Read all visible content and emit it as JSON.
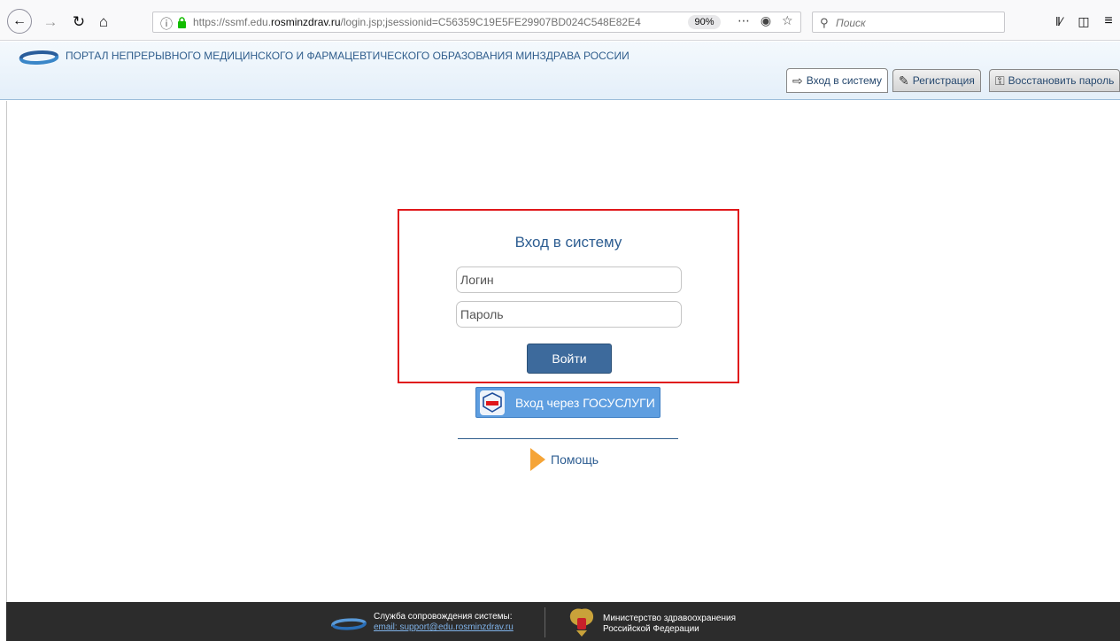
{
  "browser": {
    "url_prefix": "https://ssmf.edu.",
    "url_domain": "rosminzdrav.ru",
    "url_rest": "/login.jsp;jsessionid=C56359C19E5FE29907BD024C548E82E4",
    "zoom": "90%",
    "search_placeholder": "Поиск"
  },
  "header": {
    "title": "ПОРТАЛ НЕПРЕРЫВНОГО МЕДИЦИНСКОГО И ФАРМАЦЕВТИЧЕСКОГО ОБРАЗОВАНИЯ МИНЗДРАВА РОССИИ",
    "tabs": [
      {
        "label": "Вход в систему",
        "icon": "login-icon",
        "active": true
      },
      {
        "label": "Регистрация",
        "icon": "edit-icon",
        "active": false
      },
      {
        "label": "Восстановить пароль",
        "icon": "key-icon",
        "active": false
      }
    ]
  },
  "login": {
    "title": "Вход в систему",
    "login_placeholder": "Логин",
    "password_placeholder": "Пароль",
    "submit_label": "Войти",
    "gosuslugi_label": "Вход через ГОСУСЛУГИ",
    "help_label": "Помощь"
  },
  "footer": {
    "support_label": "Служба сопровождения системы:",
    "support_email": "email: support@edu.rosminzdrav.ru",
    "ministry_line1": "Министерство здравоохранения",
    "ministry_line2": "Российской Федерации"
  },
  "colors": {
    "accent": "#3d6a9c",
    "title_blue": "#2e5e92",
    "highlight_red": "#e0181b",
    "gosuslugi_blue": "#5e9ee0",
    "help_orange": "#f5a437",
    "footer_bg": "#2c2c2c"
  }
}
